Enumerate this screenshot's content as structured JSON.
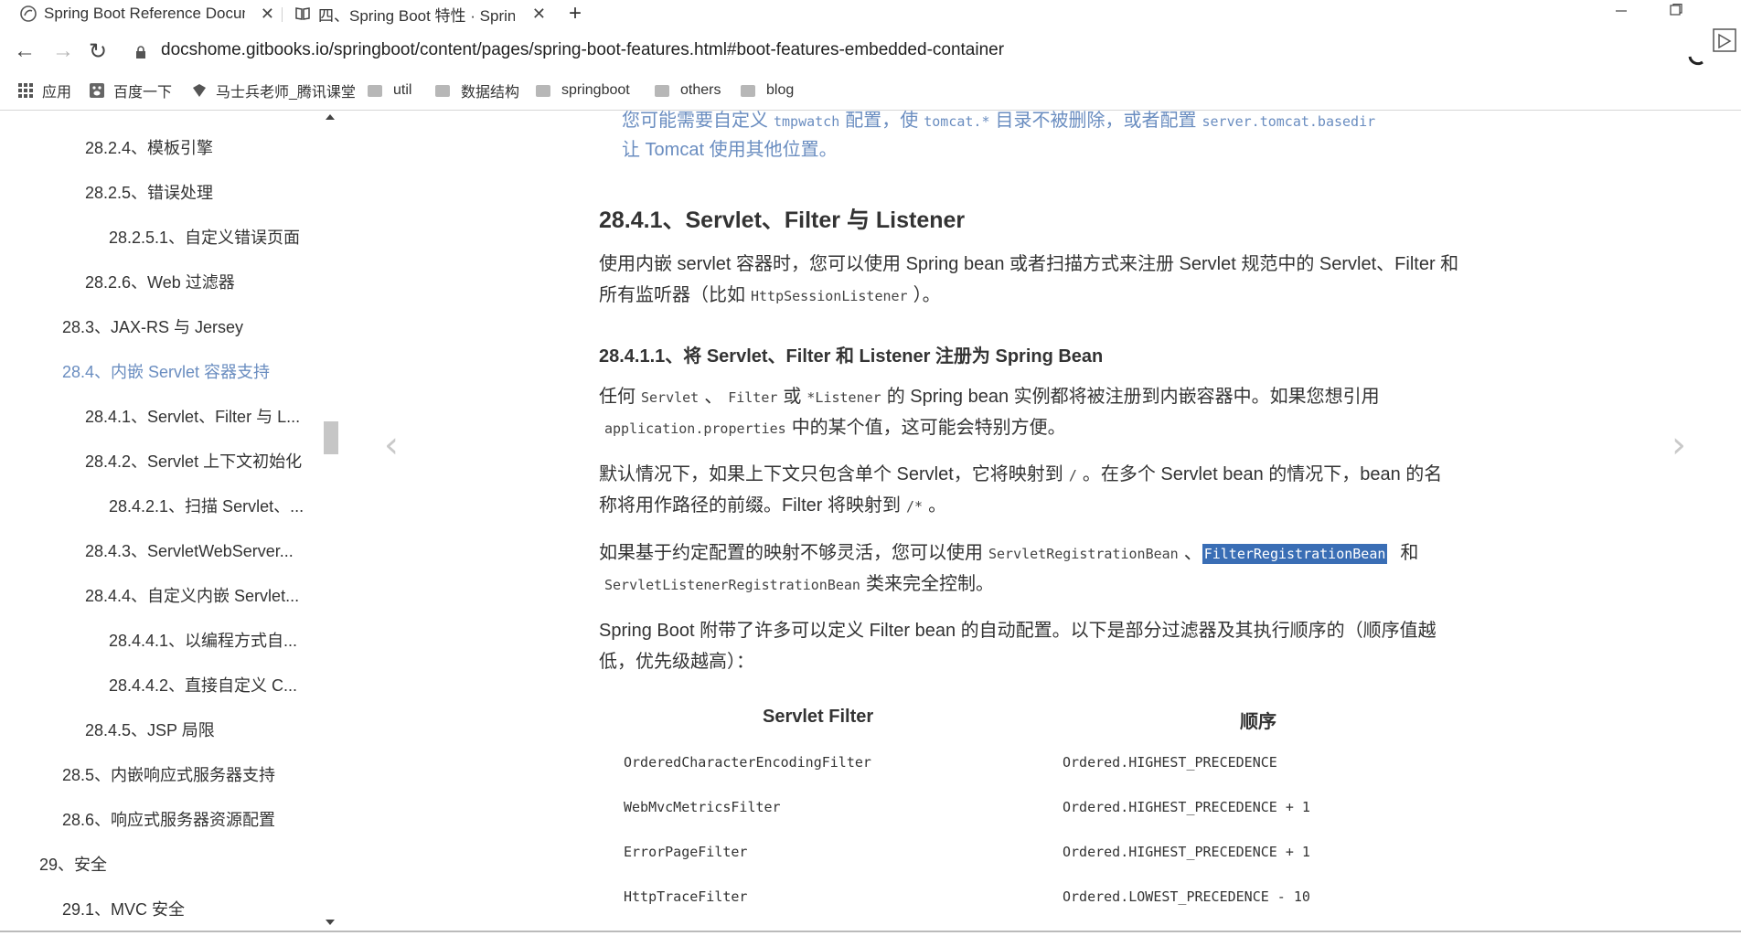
{
  "tabs": [
    {
      "title": "Spring Boot Reference Docum",
      "close": "✕"
    },
    {
      "title": "四、Spring Boot 特性 · Spring",
      "close": "✕"
    }
  ],
  "new_tab": "+",
  "nav": {
    "back": "←",
    "forward": "→",
    "reload": "↻"
  },
  "url": "docshome.gitbooks.io/springboot/content/pages/spring-boot-features.html#boot-features-embedded-container",
  "bookmarks": [
    "应用",
    "百度一下",
    "马士兵老师_腾讯课堂",
    "util",
    "数据结构",
    "springboot",
    "others",
    "blog"
  ],
  "sidebar": {
    "items": [
      {
        "label": "28.2.4、模板引擎"
      },
      {
        "label": "28.2.5、错误处理"
      },
      {
        "label": "28.2.5.1、自定义错误页面"
      },
      {
        "label": "28.2.6、Web 过滤器"
      },
      {
        "label": "28.3、JAX-RS 与 Jersey"
      },
      {
        "label": "28.4、内嵌 Servlet 容器支持"
      },
      {
        "label": "28.4.1、Servlet、Filter 与 L..."
      },
      {
        "label": "28.4.2、Servlet 上下文初始化"
      },
      {
        "label": "28.4.2.1、扫描 Servlet、..."
      },
      {
        "label": "28.4.3、ServletWebServer..."
      },
      {
        "label": "28.4.4、自定义内嵌 Servlet..."
      },
      {
        "label": "28.4.4.1、以编程方式自..."
      },
      {
        "label": "28.4.4.2、直接自定义 C..."
      },
      {
        "label": "28.4.5、JSP 局限"
      },
      {
        "label": "28.5、内嵌响应式服务器支持"
      },
      {
        "label": "28.6、响应式服务器资源配置"
      },
      {
        "label": "29、安全"
      },
      {
        "label": "29.1、MVC 安全"
      }
    ]
  },
  "main": {
    "note": {
      "line1_a": "您可能需要自定义",
      "line1_code1": "tmpwatch",
      "line1_b": "配置，使",
      "line1_code2": "tomcat.*",
      "line1_c": "目录不被删除，或者配置",
      "line1_code3": "server.tomcat.basedir",
      "line2": "让 Tomcat 使用其他位置。"
    },
    "heading": "28.4.1、Servlet、Filter 与 Listener",
    "intro": {
      "line1": "使用内嵌 servlet 容器时，您可以使用 Spring bean 或者扫描方式来注册 Servlet 规范中的 Servlet、Filter 和",
      "line2_a": "所有监听器（比如",
      "line2_code": "HttpSessionListener",
      "line2_b": "）。"
    },
    "subheading": "28.4.1.1、将 Servlet、Filter 和 Listener 注册为 Spring Bean",
    "para1": {
      "a": "任何",
      "code1": "Servlet",
      "b": "、",
      "code2": "Filter",
      "c": "或",
      "code3": "*Listener",
      "d": "的 Spring bean 实例都将被注册到内嵌容器中。如果您想引用",
      "code4": "application.properties",
      "e": "中的某个值，这可能会特别方便。"
    },
    "para2": {
      "a": "默认情况下，如果上下文只包含单个 Servlet，它将映射到",
      "code1": "/",
      "b": "。在多个 Servlet bean 的情况下，bean 的名",
      "c": "称将用作路径的前缀。Filter 将映射到",
      "code2": "/*",
      "d": "。"
    },
    "para3": {
      "a": "如果基于约定配置的映射不够灵活，您可以使用",
      "code1": "ServletRegistrationBean",
      "b": "、",
      "code2": "FilterRegistrationBean",
      "c": "和",
      "code3": "ServletListenerRegistrationBean",
      "d": "类来完全控制。"
    },
    "para4": {
      "line1": "Spring Boot 附带了许多可以定义 Filter bean 的自动配置。以下是部分过滤器及其执行顺序的（顺序值越",
      "line2": "低，优先级越高）："
    },
    "table": {
      "headers": [
        "Servlet Filter",
        "顺序"
      ],
      "rows": [
        [
          "OrderedCharacterEncodingFilter",
          "Ordered.HIGHEST_PRECEDENCE"
        ],
        [
          "WebMvcMetricsFilter",
          "Ordered.HIGHEST_PRECEDENCE + 1"
        ],
        [
          "ErrorPageFilter",
          "Ordered.HIGHEST_PRECEDENCE + 1"
        ],
        [
          "HttpTraceFilter",
          "Ordered.LOWEST_PRECEDENCE - 10"
        ]
      ]
    },
    "prev": "‹",
    "next": "›"
  }
}
